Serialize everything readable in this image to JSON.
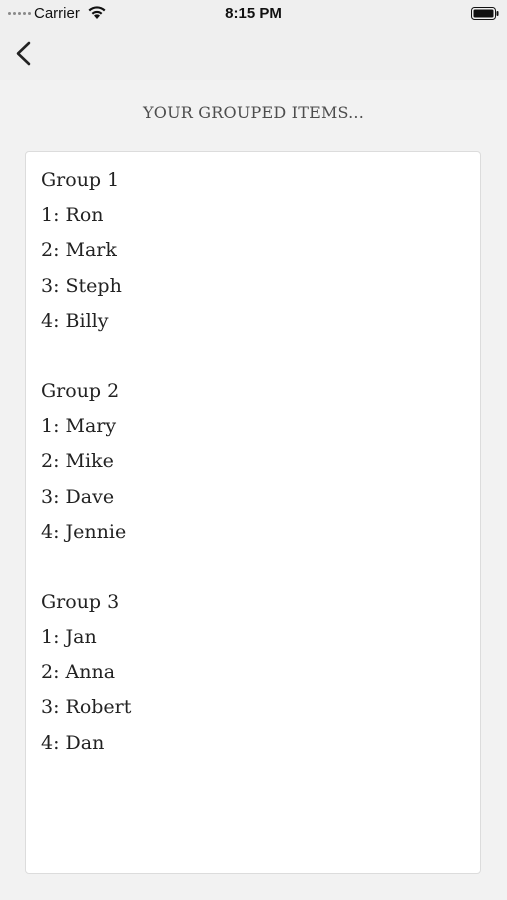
{
  "status_bar": {
    "carrier": "Carrier",
    "time": "8:15 PM"
  },
  "nav": {
    "back_icon": "chevron-left-icon"
  },
  "heading": "YOUR GROUPED ITEMS...",
  "groups": [
    {
      "title": "Group 1",
      "items": [
        "1: Ron",
        "2: Mark",
        "3: Steph",
        "4: Billy"
      ]
    },
    {
      "title": "Group 2",
      "items": [
        "1: Mary",
        "2: Mike",
        "3: Dave",
        "4: Jennie"
      ]
    },
    {
      "title": "Group 3",
      "items": [
        "1: Jan",
        "2: Anna",
        "3: Robert",
        "4: Dan"
      ]
    }
  ],
  "colors": {
    "background": "#f2f2f2",
    "card": "#ffffff",
    "text": "#222222",
    "heading": "#4d4d4d"
  }
}
